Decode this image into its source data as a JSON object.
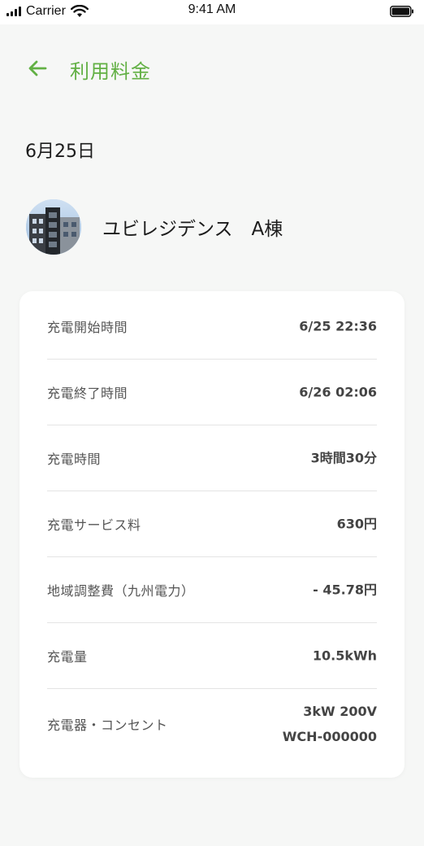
{
  "status_bar": {
    "carrier": "Carrier",
    "time": "9:41 AM"
  },
  "header": {
    "title": "利用料金",
    "back_icon": "arrow-left-icon",
    "accent_color": "#62b044"
  },
  "date": "6月25日",
  "facility": {
    "name": "ユビレジデンス　A棟",
    "avatar": "building-photo"
  },
  "details": [
    {
      "label": "充電開始時間",
      "value": "6/25 22:36"
    },
    {
      "label": "充電終了時間",
      "value": "6/26 02:06"
    },
    {
      "label": "充電時間",
      "value": "3時間30分"
    },
    {
      "label": "充電サービス料",
      "value": "630円"
    },
    {
      "label": "地域調整費（九州電力）",
      "value": "- 45.78円"
    },
    {
      "label": "充電量",
      "value": "10.5kWh"
    },
    {
      "label": "充電器・コンセント",
      "value_line1": "3kW 200V",
      "value_line2": "WCH-000000"
    }
  ]
}
